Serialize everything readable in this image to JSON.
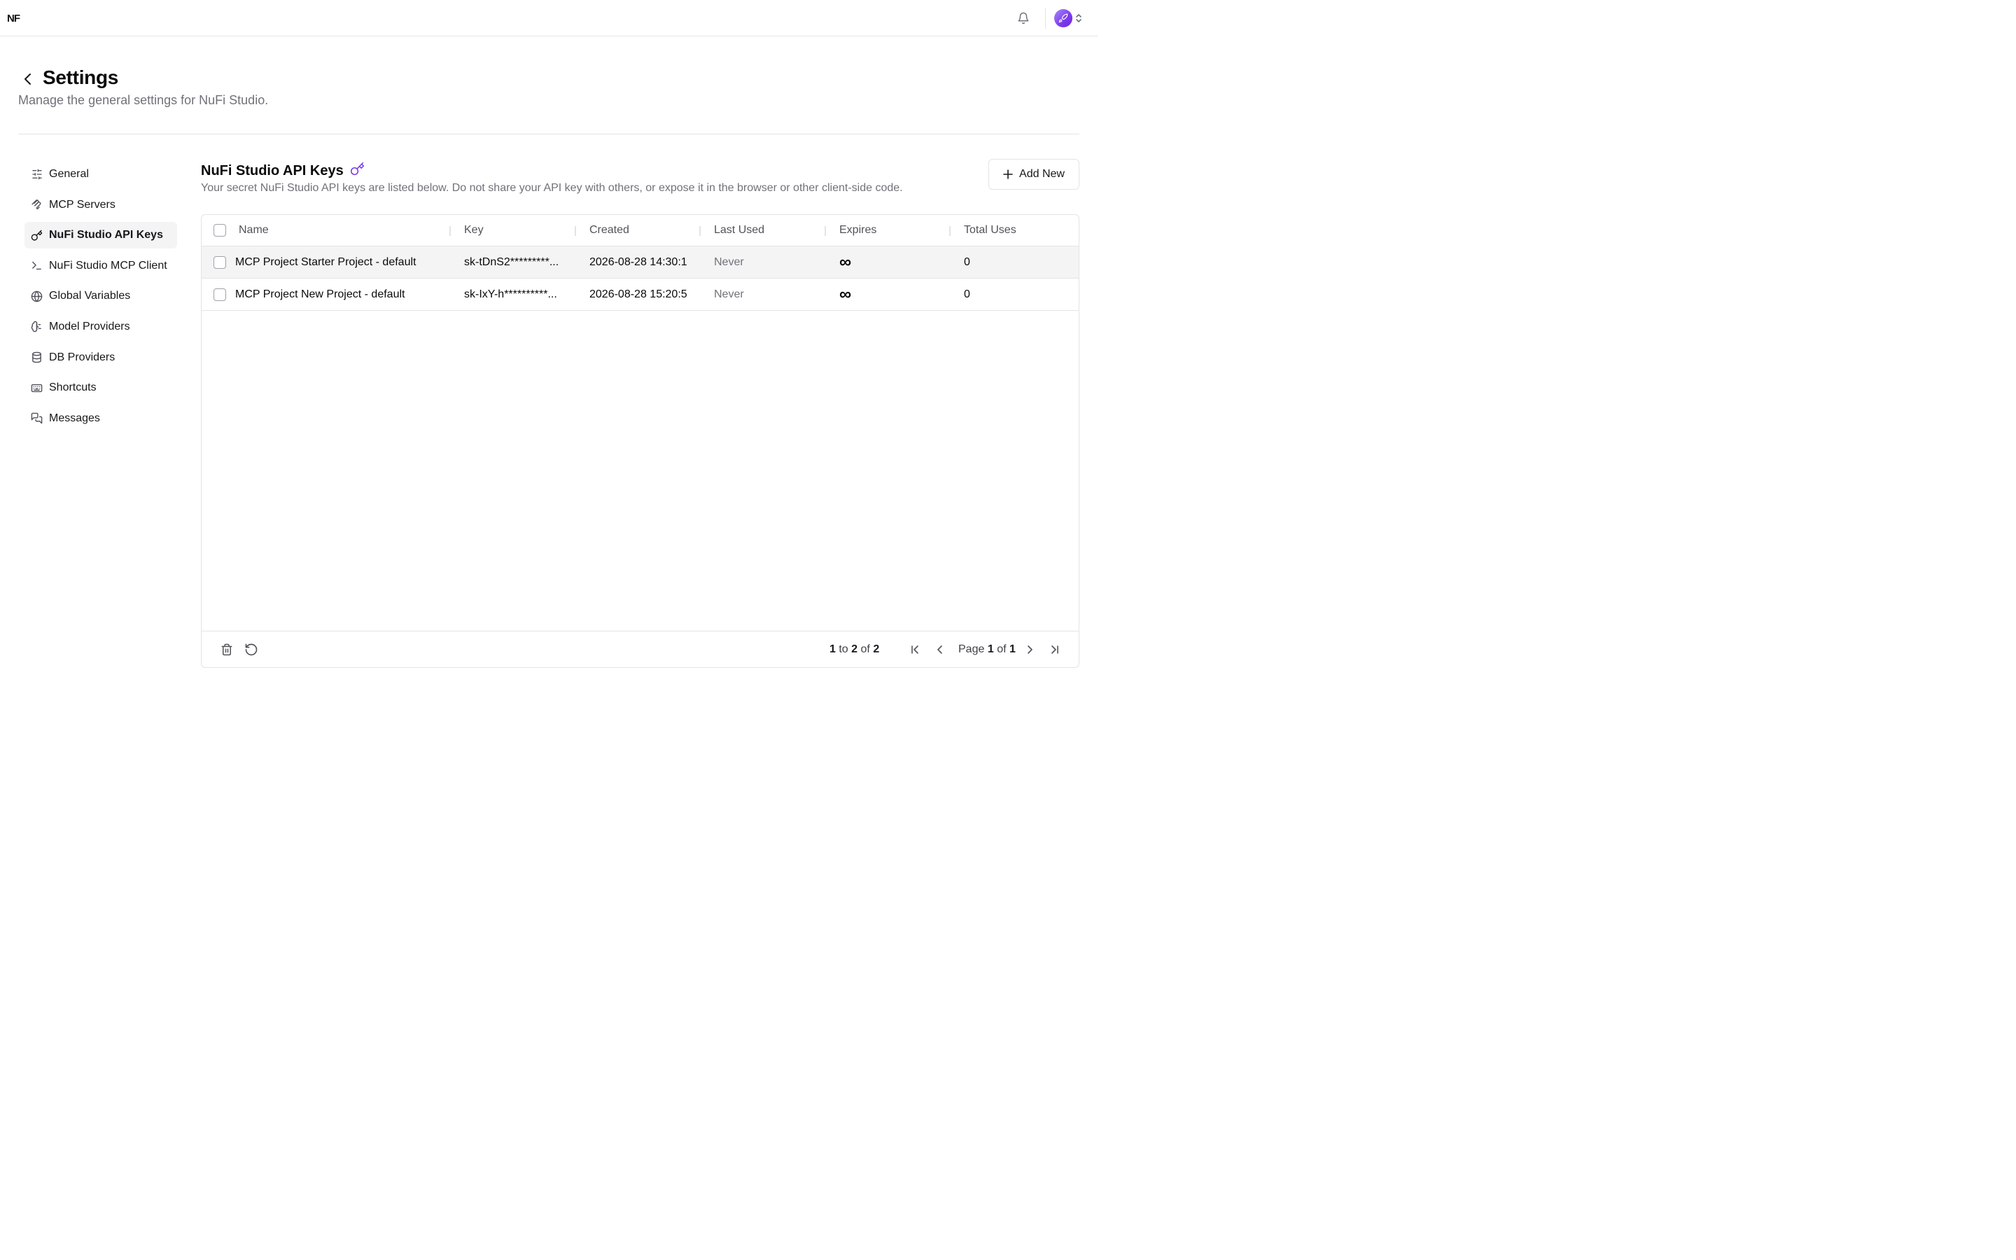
{
  "topbar": {
    "logo_text": "NF",
    "bell_icon": "bell-icon",
    "avatar_icon": "rocket-avatar-icon",
    "avatar_color": "#7c3aed"
  },
  "header": {
    "title": "Settings",
    "subtitle": "Manage the general settings for NuFi Studio."
  },
  "sidebar": {
    "items": [
      {
        "label": "General",
        "icon": "sliders-icon",
        "active": false
      },
      {
        "label": "MCP Servers",
        "icon": "mcp-icon",
        "active": false
      },
      {
        "label": "NuFi Studio API Keys",
        "icon": "key-icon",
        "active": true
      },
      {
        "label": "NuFi Studio MCP Client",
        "icon": "terminal-icon",
        "active": false
      },
      {
        "label": "Global Variables",
        "icon": "globe-icon",
        "active": false
      },
      {
        "label": "Model Providers",
        "icon": "brain-icon",
        "active": false
      },
      {
        "label": "DB Providers",
        "icon": "database-icon",
        "active": false
      },
      {
        "label": "Shortcuts",
        "icon": "keyboard-icon",
        "active": false
      },
      {
        "label": "Messages",
        "icon": "messages-icon",
        "active": false
      }
    ]
  },
  "section": {
    "title": "NuFi Studio API Keys",
    "title_icon": "key-icon",
    "accent": "#7c3aed",
    "description": "Your secret NuFi Studio API keys are listed below. Do not share your API key with others, or expose it in the browser or other client-side code.",
    "add_button_label": "Add New"
  },
  "table": {
    "columns": [
      "Name",
      "Key",
      "Created",
      "Last Used",
      "Expires",
      "Total Uses"
    ],
    "rows": [
      {
        "name": "MCP Project Starter Project - default",
        "key": "sk-tDnS2*********...",
        "created": "2026-08-28 14:30:1",
        "last_used": "Never",
        "expires": "∞",
        "total_uses": "0"
      },
      {
        "name": "MCP Project New Project - default",
        "key": "sk-IxY-h**********...",
        "created": "2026-08-28 15:20:5",
        "last_used": "Never",
        "expires": "∞",
        "total_uses": "0"
      }
    ]
  },
  "footer": {
    "range_from": "1",
    "range_to_word": "to",
    "range_to": "2",
    "range_of_word": "of",
    "range_total": "2",
    "page_word": "Page",
    "page_current": "1",
    "page_of_word": "of",
    "page_total": "1"
  }
}
